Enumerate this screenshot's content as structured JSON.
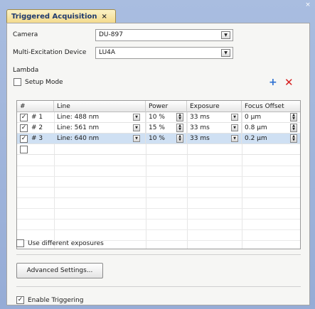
{
  "window": {
    "close_glyph": "×"
  },
  "tab": {
    "label": "Triggered Acquisition",
    "close_glyph": "×"
  },
  "camera": {
    "label": "Camera",
    "value": "DU-897"
  },
  "device": {
    "label": "Multi-Excitation Device",
    "value": "LU4A"
  },
  "lambda": {
    "section_label": "Lambda",
    "setup_mode_label": "Setup Mode",
    "setup_mode_checked": false,
    "add_glyph": "+",
    "delete_glyph": "✕"
  },
  "table": {
    "columns": [
      "#",
      "Line",
      "Power",
      "Exposure",
      "Focus Offset"
    ],
    "rows": [
      {
        "checked": true,
        "index": "# 1",
        "line": "Line:  488 nm",
        "power": "10 %",
        "exposure": "33 ms",
        "focus": "0 µm",
        "selected": false
      },
      {
        "checked": true,
        "index": "# 2",
        "line": "Line:  561 nm",
        "power": "15 %",
        "exposure": "33 ms",
        "focus": "0.8 µm",
        "selected": false
      },
      {
        "checked": true,
        "index": "# 3",
        "line": "Line:  640 nm",
        "power": "10 %",
        "exposure": "33 ms",
        "focus": "0.2 µm",
        "selected": true
      }
    ],
    "check_glyph": "✓",
    "dropdown_glyph": "▼",
    "spin_up_glyph": "▲",
    "spin_down_glyph": "▼"
  },
  "options": {
    "different_exposures_label": "Use different exposures",
    "different_exposures_checked": false,
    "advanced_button": "Advanced Settings...",
    "enable_triggering_label": "Enable Triggering",
    "enable_triggering_checked": true
  }
}
